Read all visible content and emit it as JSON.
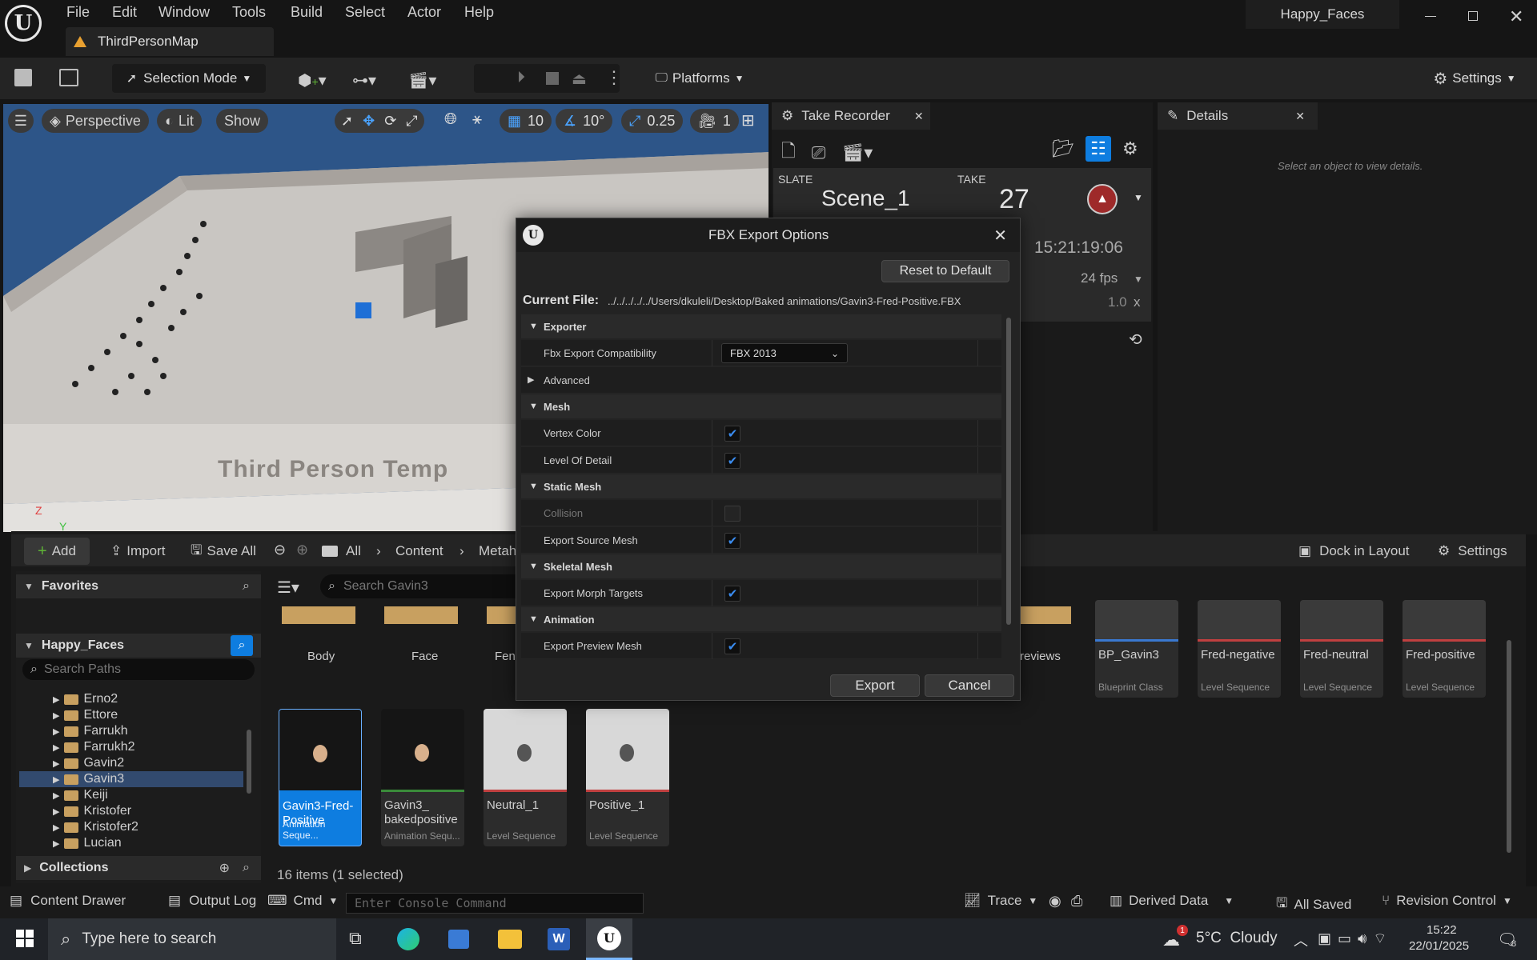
{
  "app": {
    "project_name": "Happy_Faces",
    "map_tab": "ThirdPersonMap",
    "menu": [
      "File",
      "Edit",
      "Window",
      "Tools",
      "Build",
      "Select",
      "Actor",
      "Help"
    ]
  },
  "toolbar": {
    "selection_mode": "Selection Mode",
    "platforms": "Platforms",
    "settings": "Settings"
  },
  "viewport": {
    "perspective": "Perspective",
    "lit": "Lit",
    "show": "Show",
    "grid_snap": "10",
    "angle_snap": "10°",
    "scale_snap": "0.25",
    "camera_speed": "1",
    "watermark": "Third Person Temp",
    "axis_z": "Z",
    "axis_y": "Y"
  },
  "take_recorder": {
    "tab": "Take Recorder",
    "slate_label": "SLATE",
    "take_label": "TAKE",
    "slate": "Scene_1",
    "take": "27",
    "timecode": "15:21:19:06",
    "fps": "24 fps",
    "speed": "1.0",
    "speed_unit": "x"
  },
  "details": {
    "tab": "Details",
    "empty": "Select an object to view details."
  },
  "dialog": {
    "title": "FBX Export Options",
    "reset": "Reset to Default",
    "current_file_label": "Current File:",
    "current_file": "../../../../../Users/dkuleli/Desktop/Baked animations/Gavin3-Fred-Positive.FBX",
    "sections": {
      "exporter": "Exporter",
      "mesh": "Mesh",
      "static_mesh": "Static Mesh",
      "skeletal_mesh": "Skeletal Mesh",
      "animation": "Animation"
    },
    "rows": {
      "compat_label": "Fbx Export Compatibility",
      "compat_value": "FBX 2013",
      "advanced": "Advanced",
      "vertex_color": "Vertex Color",
      "lod": "Level Of Detail",
      "collision": "Collision",
      "export_source_mesh": "Export Source Mesh",
      "export_morph": "Export Morph Targets",
      "export_preview": "Export Preview Mesh"
    },
    "export": "Export",
    "cancel": "Cancel"
  },
  "content_browser": {
    "add": "Add",
    "import": "Import",
    "save_all": "Save All",
    "crumbs": [
      "All",
      "Content",
      "Metah"
    ],
    "dock": "Dock in Layout",
    "settings": "Settings",
    "favorites": "Favorites",
    "project": "Happy_Faces",
    "search_paths": "Search Paths",
    "search_assets": "Search Gavin3",
    "folders": [
      "Erno2",
      "Ettore",
      "Farrukh",
      "Farrukh2",
      "Gavin2",
      "Gavin3",
      "Keiji",
      "Kristofer",
      "Kristofer2",
      "Lucian"
    ],
    "collections": "Collections",
    "count": "16 items (1 selected)",
    "top_tiles": [
      "Body",
      "Face",
      "Fen",
      "reviews"
    ],
    "right_tiles": [
      {
        "name": "BP_Gavin3",
        "type": "Blueprint Class"
      },
      {
        "name": "Fred-negative",
        "type": "Level Sequence"
      },
      {
        "name": "Fred-neutral",
        "type": "Level Sequence"
      },
      {
        "name": "Fred-positive",
        "type": "Level Sequence"
      }
    ],
    "assets": [
      {
        "name": "Gavin3-Fred-Positive",
        "type": "Animation Seque..."
      },
      {
        "name": "Gavin3_ bakedpositive",
        "type": "Animation Sequ..."
      },
      {
        "name": "Neutral_1",
        "type": "Level Sequence"
      },
      {
        "name": "Positive_1",
        "type": "Level Sequence"
      }
    ]
  },
  "status": {
    "content_drawer": "Content Drawer",
    "output_log": "Output Log",
    "cmd": "Cmd",
    "console_placeholder": "Enter Console Command",
    "trace": "Trace",
    "derived_data": "Derived Data",
    "all_saved": "All Saved",
    "revision_control": "Revision Control"
  },
  "taskbar": {
    "search": "Type here to search",
    "weather": "5°C  Cloudy",
    "time": "15:22",
    "date": "22/01/2025",
    "notif": "8",
    "badge": "1"
  },
  "colors": {
    "accent": "#0e7de0",
    "play": "#5fb336",
    "warning": "#9e2a2a"
  }
}
